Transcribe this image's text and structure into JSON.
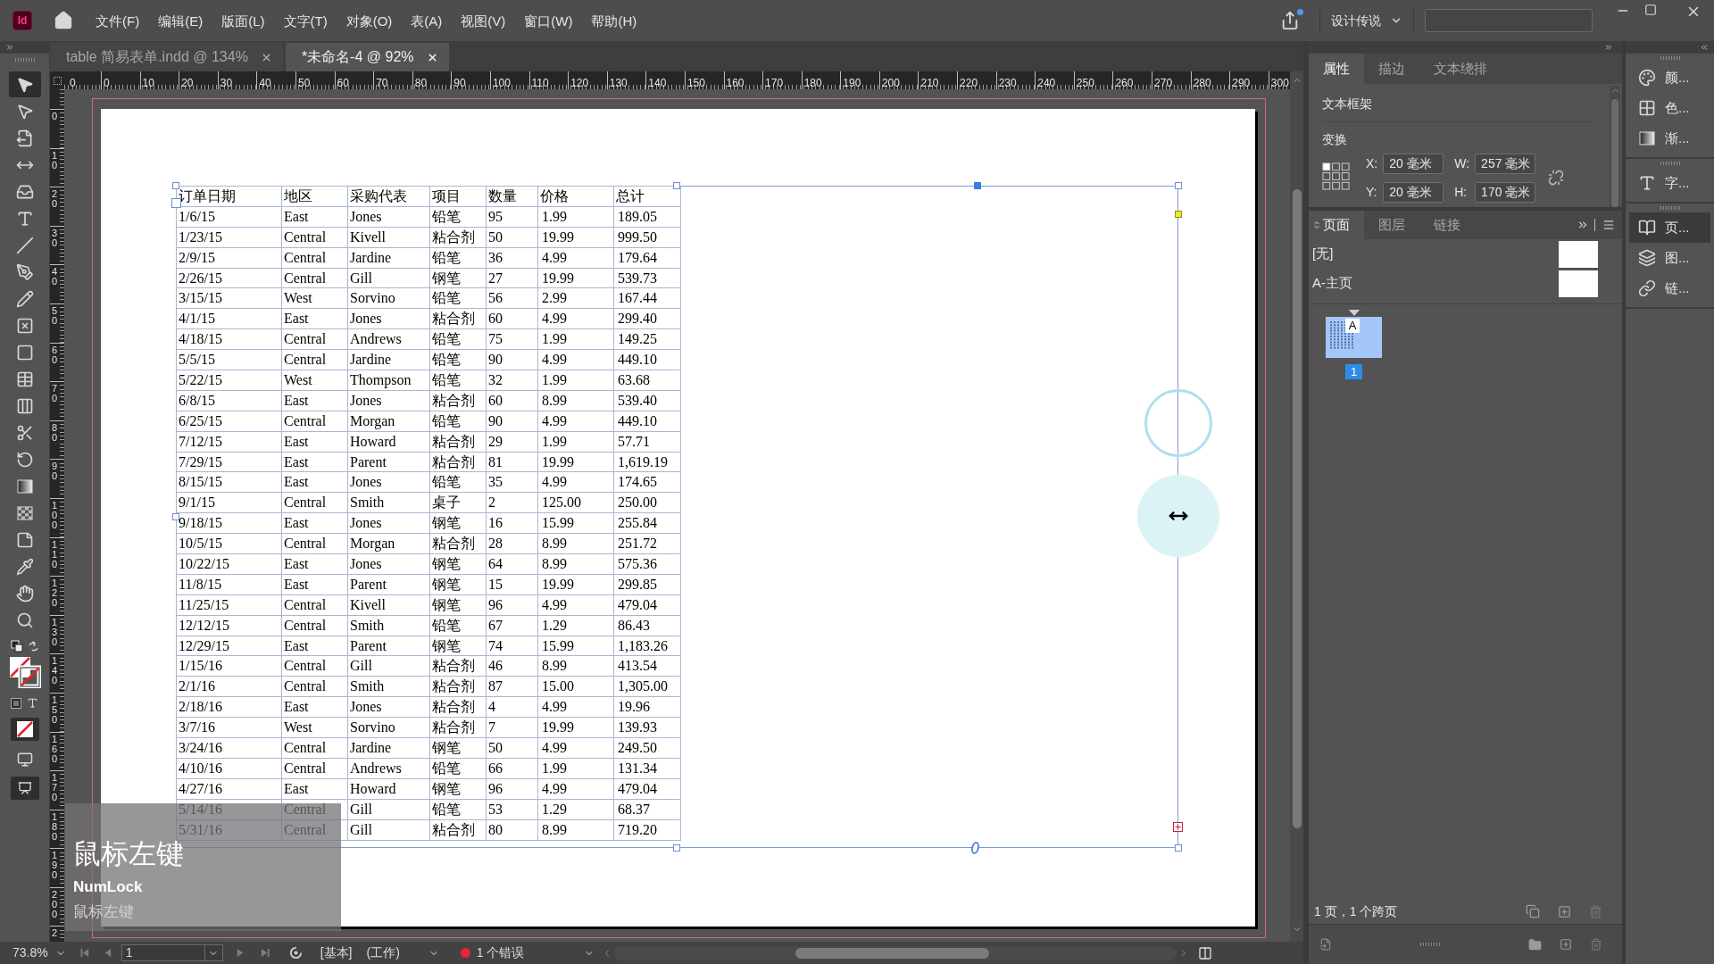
{
  "app_bar": {
    "logo": "Id",
    "menus": [
      "文件(F)",
      "编辑(E)",
      "版面(L)",
      "文字(T)",
      "对象(O)",
      "表(A)",
      "视图(V)",
      "窗口(W)",
      "帮助(H)"
    ],
    "workspace": "设计传说"
  },
  "toolbar": {
    "tools": [
      {
        "selected": true
      },
      {
        "selected": false
      },
      {
        "selected": false
      },
      {
        "selected": false
      },
      {
        "selected": false
      },
      {
        "selected": false
      },
      {
        "selected": false
      },
      {
        "selected": false
      },
      {
        "selected": false
      },
      {
        "selected": false
      },
      {
        "selected": false
      },
      {
        "selected": false
      },
      {
        "selected": false
      },
      {
        "selected": false
      },
      {
        "selected": false
      },
      {
        "selected": false
      },
      {
        "selected": false
      },
      {
        "selected": false
      },
      {
        "selected": false
      },
      {
        "selected": false
      },
      {
        "selected": false
      }
    ]
  },
  "document_tabs": [
    {
      "label": "table 简易表单.indd @ 134%",
      "selected": false
    },
    {
      "label": "*未命名-4 @ 92%",
      "selected": true
    }
  ],
  "horizontal_ruler": {
    "labels": [
      "0",
      "0",
      "10",
      "20",
      "30",
      "40",
      "50",
      "60",
      "70",
      "80",
      "90",
      "100",
      "110",
      "120",
      "130",
      "140",
      "150",
      "160",
      "170",
      "180",
      "190",
      "200",
      "210",
      "220",
      "230",
      "240",
      "250",
      "260",
      "270",
      "280",
      "290",
      "300"
    ]
  },
  "vertical_ruler": {
    "labels": [
      "0",
      "10",
      "20",
      "30",
      "40",
      "50",
      "60",
      "70",
      "80",
      "90",
      "100",
      "110",
      "120",
      "130",
      "140",
      "150",
      "160",
      "170",
      "180",
      "190",
      "200",
      "2"
    ]
  },
  "table": {
    "columns": [
      "订单日期",
      "地区",
      "采购代表",
      "项目",
      "数量",
      "价格",
      "总计"
    ],
    "rows": [
      [
        "1/6/15",
        "East",
        "Jones",
        "铅笔",
        "95",
        "1.99",
        "189.05"
      ],
      [
        "1/23/15",
        "Central",
        "Kivell",
        "粘合剂",
        "50",
        "19.99",
        "999.50"
      ],
      [
        "2/9/15",
        "Central",
        "Jardine",
        "铅笔",
        "36",
        "4.99",
        "179.64"
      ],
      [
        "2/26/15",
        "Central",
        "Gill",
        "钢笔",
        "27",
        "19.99",
        "539.73"
      ],
      [
        "3/15/15",
        "West",
        "Sorvino",
        "铅笔",
        "56",
        "2.99",
        "167.44"
      ],
      [
        "4/1/15",
        "East",
        "Jones",
        "粘合剂",
        "60",
        "4.99",
        "299.40"
      ],
      [
        "4/18/15",
        "Central",
        "Andrews",
        "铅笔",
        "75",
        "1.99",
        "149.25"
      ],
      [
        "5/5/15",
        "Central",
        "Jardine",
        "铅笔",
        "90",
        "4.99",
        "449.10"
      ],
      [
        "5/22/15",
        "West",
        "Thompson",
        "铅笔",
        "32",
        "1.99",
        "63.68"
      ],
      [
        "6/8/15",
        "East",
        "Jones",
        "粘合剂",
        "60",
        "8.99",
        "539.40"
      ],
      [
        "6/25/15",
        "Central",
        "Morgan",
        "铅笔",
        "90",
        "4.99",
        "449.10"
      ],
      [
        "7/12/15",
        "East",
        "Howard",
        "粘合剂",
        "29",
        "1.99",
        "57.71"
      ],
      [
        "7/29/15",
        "East",
        "Parent",
        "粘合剂",
        "81",
        "19.99",
        "1,619.19"
      ],
      [
        "8/15/15",
        "East",
        "Jones",
        "铅笔",
        "35",
        "4.99",
        "174.65"
      ],
      [
        "9/1/15",
        "Central",
        "Smith",
        "桌子",
        "2",
        "125.00",
        "250.00"
      ],
      [
        "9/18/15",
        "East",
        "Jones",
        "钢笔",
        "16",
        "15.99",
        "255.84"
      ],
      [
        "10/5/15",
        "Central",
        "Morgan",
        "粘合剂",
        "28",
        "8.99",
        "251.72"
      ],
      [
        "10/22/15",
        "East",
        "Jones",
        "钢笔",
        "64",
        "8.99",
        "575.36"
      ],
      [
        "11/8/15",
        "East",
        "Parent",
        "钢笔",
        "15",
        "19.99",
        "299.85"
      ],
      [
        "11/25/15",
        "Central",
        "Kivell",
        "钢笔",
        "96",
        "4.99",
        "479.04"
      ],
      [
        "12/12/15",
        "Central",
        "Smith",
        "铅笔",
        "67",
        "1.29",
        "86.43"
      ],
      [
        "12/29/15",
        "East",
        "Parent",
        "钢笔",
        "74",
        "15.99",
        "1,183.26"
      ],
      [
        "1/15/16",
        "Central",
        "Gill",
        "粘合剂",
        "46",
        "8.99",
        "413.54"
      ],
      [
        "2/1/16",
        "Central",
        "Smith",
        "粘合剂",
        "87",
        "15.00",
        "1,305.00"
      ],
      [
        "2/18/16",
        "East",
        "Jones",
        "粘合剂",
        "4",
        "4.99",
        "19.96"
      ],
      [
        "3/7/16",
        "West",
        "Sorvino",
        "粘合剂",
        "7",
        "19.99",
        "139.93"
      ],
      [
        "3/24/16",
        "Central",
        "Jardine",
        "钢笔",
        "50",
        "4.99",
        "249.50"
      ],
      [
        "4/10/16",
        "Central",
        "Andrews",
        "铅笔",
        "66",
        "1.99",
        "131.34"
      ],
      [
        "4/27/16",
        "East",
        "Howard",
        "钢笔",
        "96",
        "4.99",
        "479.04"
      ],
      [
        "5/14/16",
        "Central",
        "Gill",
        "铅笔",
        "53",
        "1.29",
        "68.37"
      ],
      [
        "5/31/16",
        "Central",
        "Gill",
        "粘合剂",
        "80",
        "8.99",
        "719.20"
      ]
    ]
  },
  "properties_panel": {
    "tabs": [
      {
        "label": "属性",
        "selected": true
      },
      {
        "label": "描边",
        "selected": false
      },
      {
        "label": "文本绕排",
        "selected": false
      }
    ],
    "object_type": "文本框架",
    "section_title": "变换",
    "fields": [
      {
        "label": "X:",
        "value": "20 毫米"
      },
      {
        "label": "W:",
        "value": "257 毫米"
      },
      {
        "label": "Y:",
        "value": "20 毫米"
      },
      {
        "label": "H:",
        "value": "170 毫米"
      }
    ]
  },
  "pages_panel": {
    "tabs": [
      {
        "label": "页面",
        "selected": true
      },
      {
        "label": "图层",
        "selected": false
      },
      {
        "label": "链接",
        "selected": false
      }
    ],
    "masters": [
      {
        "name": "[无]"
      },
      {
        "name": "A-主页"
      }
    ],
    "page": {
      "master": "A",
      "number": "1",
      "selected": true
    },
    "summary": "1 页，1 个跨页"
  },
  "panel_dock": {
    "groups": [
      [
        {
          "label": "颜...",
          "selected": false
        },
        {
          "label": "色...",
          "selected": false
        },
        {
          "label": "渐...",
          "selected": false
        }
      ],
      [
        {
          "label": "字...",
          "selected": false
        }
      ],
      [
        {
          "label": "页...",
          "selected": true
        },
        {
          "label": "图...",
          "selected": false
        },
        {
          "label": "链...",
          "selected": false
        }
      ]
    ]
  },
  "status_bar": {
    "zoom": "73.8%",
    "page": "1",
    "profile": "[基本]",
    "mode": "(工作)",
    "errors": "1 个错误"
  },
  "key_overlay": {
    "key": "鼠标左键",
    "modifier": "NumLock",
    "caption": "鼠标左键"
  }
}
